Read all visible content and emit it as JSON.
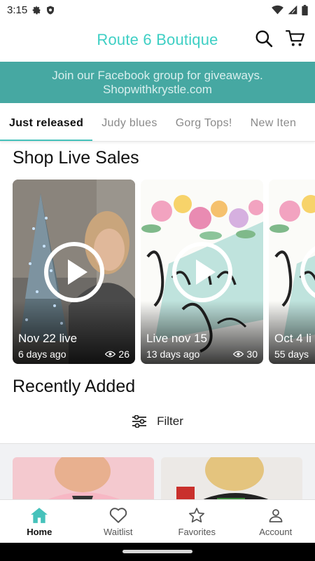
{
  "status_bar": {
    "time": "3:15"
  },
  "header": {
    "title": "Route 6 Boutique"
  },
  "banner": {
    "line1": "Join our Facebook group for giveaways.",
    "line2": "Shopwithkrystle.com"
  },
  "tabs": [
    {
      "label": "Just released",
      "active": true
    },
    {
      "label": "Judy blues",
      "active": false
    },
    {
      "label": "Gorg Tops!",
      "active": false
    },
    {
      "label": "New Iten",
      "active": false
    }
  ],
  "live_section": {
    "title": "Shop Live Sales",
    "cards": [
      {
        "title": "Nov 22 live",
        "age": "6 days ago",
        "views": "26"
      },
      {
        "title": "Live nov 15",
        "age": "13 days ago",
        "views": "30"
      },
      {
        "title": "Oct 4 li",
        "age": "55 days",
        "views": ""
      }
    ]
  },
  "recent_section": {
    "title": "Recently Added",
    "filter_label": "Filter"
  },
  "bottom_nav": [
    {
      "label": "Home",
      "icon": "home-icon",
      "active": true
    },
    {
      "label": "Waitlist",
      "icon": "heart-icon",
      "active": false
    },
    {
      "label": "Favorites",
      "icon": "star-icon",
      "active": false
    },
    {
      "label": "Account",
      "icon": "account-icon",
      "active": false
    }
  ],
  "colors": {
    "brand": "#3ecfc4",
    "banner": "#46a8a2",
    "tab_underline": "#46c2bb"
  }
}
